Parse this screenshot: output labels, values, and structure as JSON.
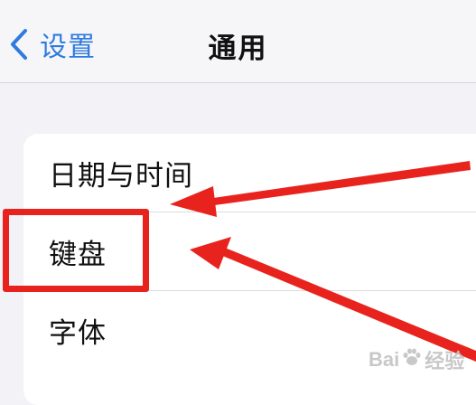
{
  "navbar": {
    "back_label": "设置",
    "title": "通用",
    "accent_color": "#2f7be0"
  },
  "settings_list": {
    "items": [
      {
        "label": "日期与时间"
      },
      {
        "label": "键盘"
      },
      {
        "label": "字体"
      }
    ]
  },
  "annotations": {
    "highlight_color": "#e8231d",
    "highlighted_item": "键盘"
  },
  "watermark": {
    "text_left": "Bai",
    "text_right": "经验",
    "icon": "paw-icon"
  }
}
